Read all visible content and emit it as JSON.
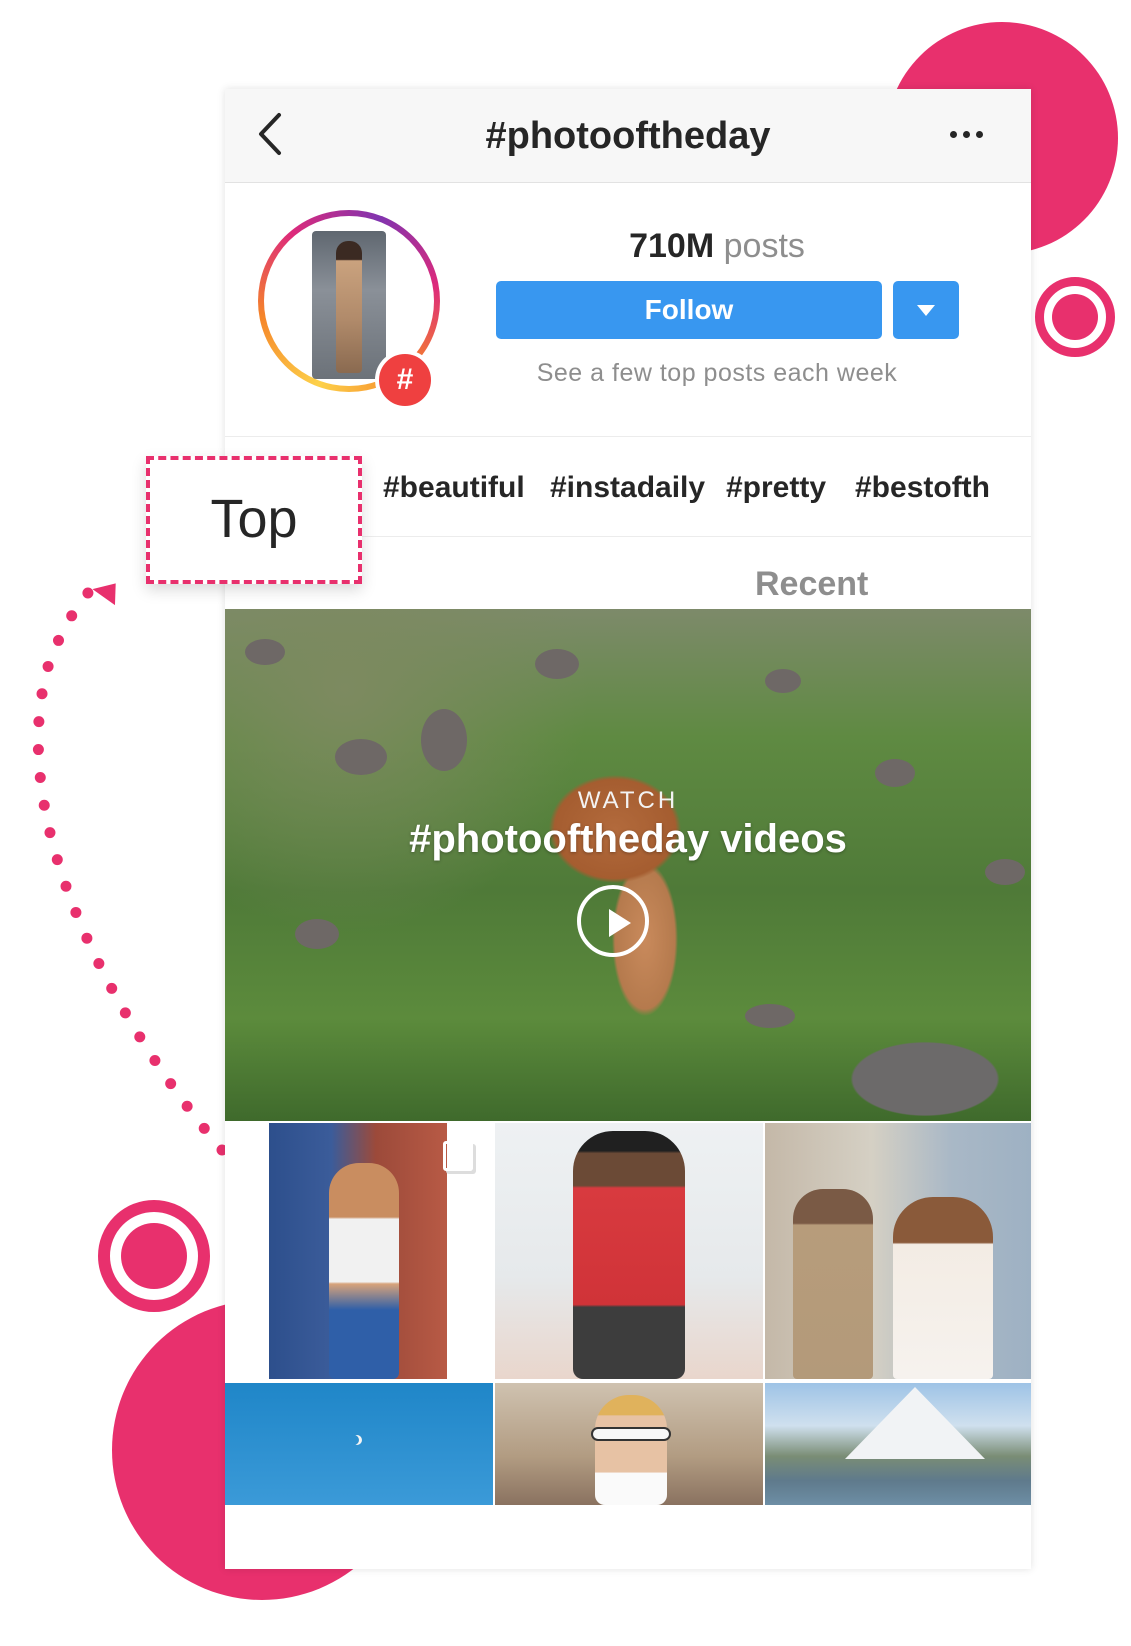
{
  "header": {
    "title": "#photooftheday"
  },
  "profile": {
    "post_count": "710M",
    "post_label": "posts",
    "follow_label": "Follow",
    "subtext": "See a few top posts each week"
  },
  "related_tags": [
    "#beautiful",
    "#instadaily",
    "#pretty",
    "#bestofth"
  ],
  "tabs": {
    "top": "Top",
    "recent": "Recent"
  },
  "video": {
    "watch_label": "WATCH",
    "title": "#photooftheday videos"
  },
  "colors": {
    "accent_pink": "#e8306d",
    "follow_blue": "#3897f0",
    "hash_badge": "#ef4040"
  },
  "icons": [
    "back-chevron-icon",
    "more-options-icon",
    "hashtag-badge-icon",
    "dropdown-caret-icon",
    "play-icon",
    "multiple-posts-icon"
  ]
}
